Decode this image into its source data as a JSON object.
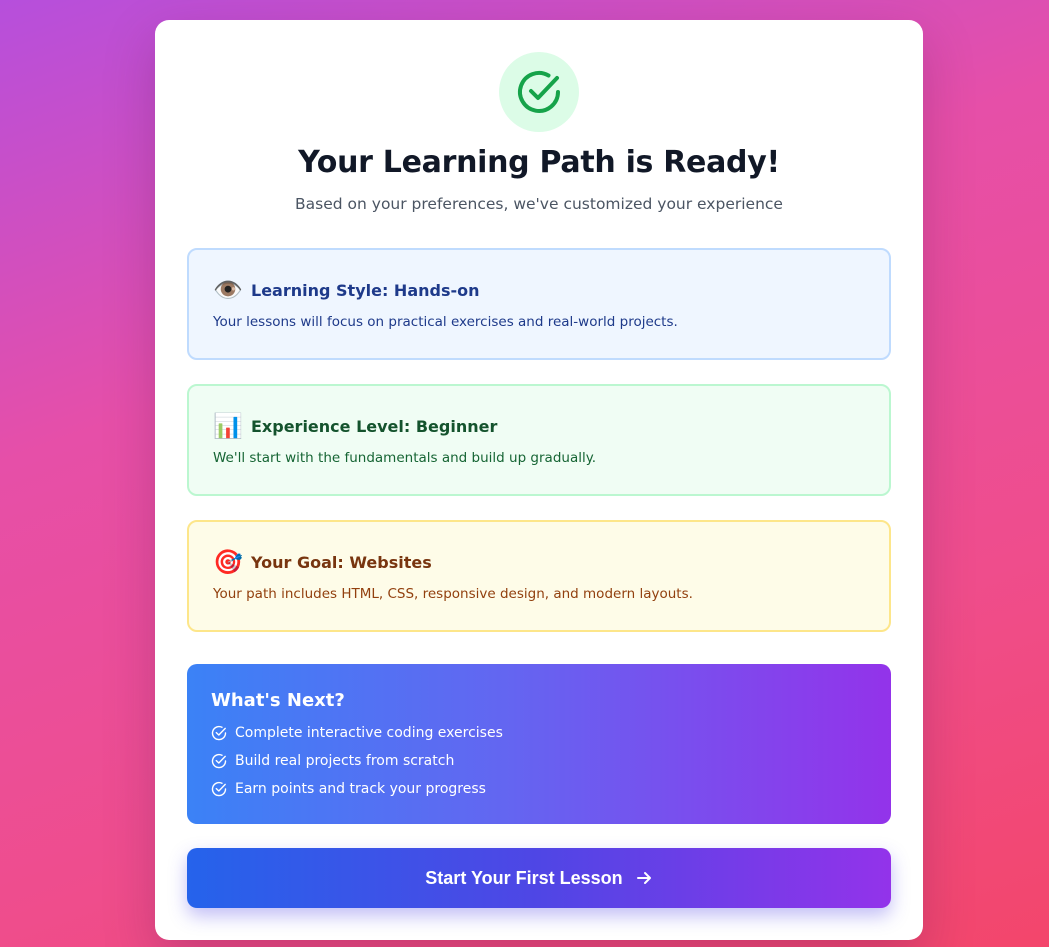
{
  "header": {
    "title": "Your Learning Path is Ready!",
    "subtitle": "Based on your preferences, we've customized your experience",
    "icon": "check-circle-icon",
    "accent_color": "#16a34a"
  },
  "summary_cards": [
    {
      "icon": "eye-icon",
      "emoji": "👁️",
      "title": "Learning Style: Hands-on",
      "description": "Your lessons will focus on practical exercises and real-world projects.",
      "color": "#eff6ff"
    },
    {
      "icon": "bar-chart-icon",
      "emoji": "📊",
      "title": "Experience Level: Beginner",
      "description": "We'll start with the fundamentals and build up gradually.",
      "color": "#f0fdf4"
    },
    {
      "icon": "target-icon",
      "emoji": "🎯",
      "title": "Your Goal: Websites",
      "description": "Your path includes HTML, CSS, responsive design, and modern layouts.",
      "color": "#fefce8"
    }
  ],
  "whats_next": {
    "title": "What's Next?",
    "items": [
      "Complete interactive coding exercises",
      "Build real projects from scratch",
      "Earn points and track your progress"
    ]
  },
  "cta": {
    "label": "Start Your First Lesson",
    "icon": "arrow-right-icon"
  }
}
